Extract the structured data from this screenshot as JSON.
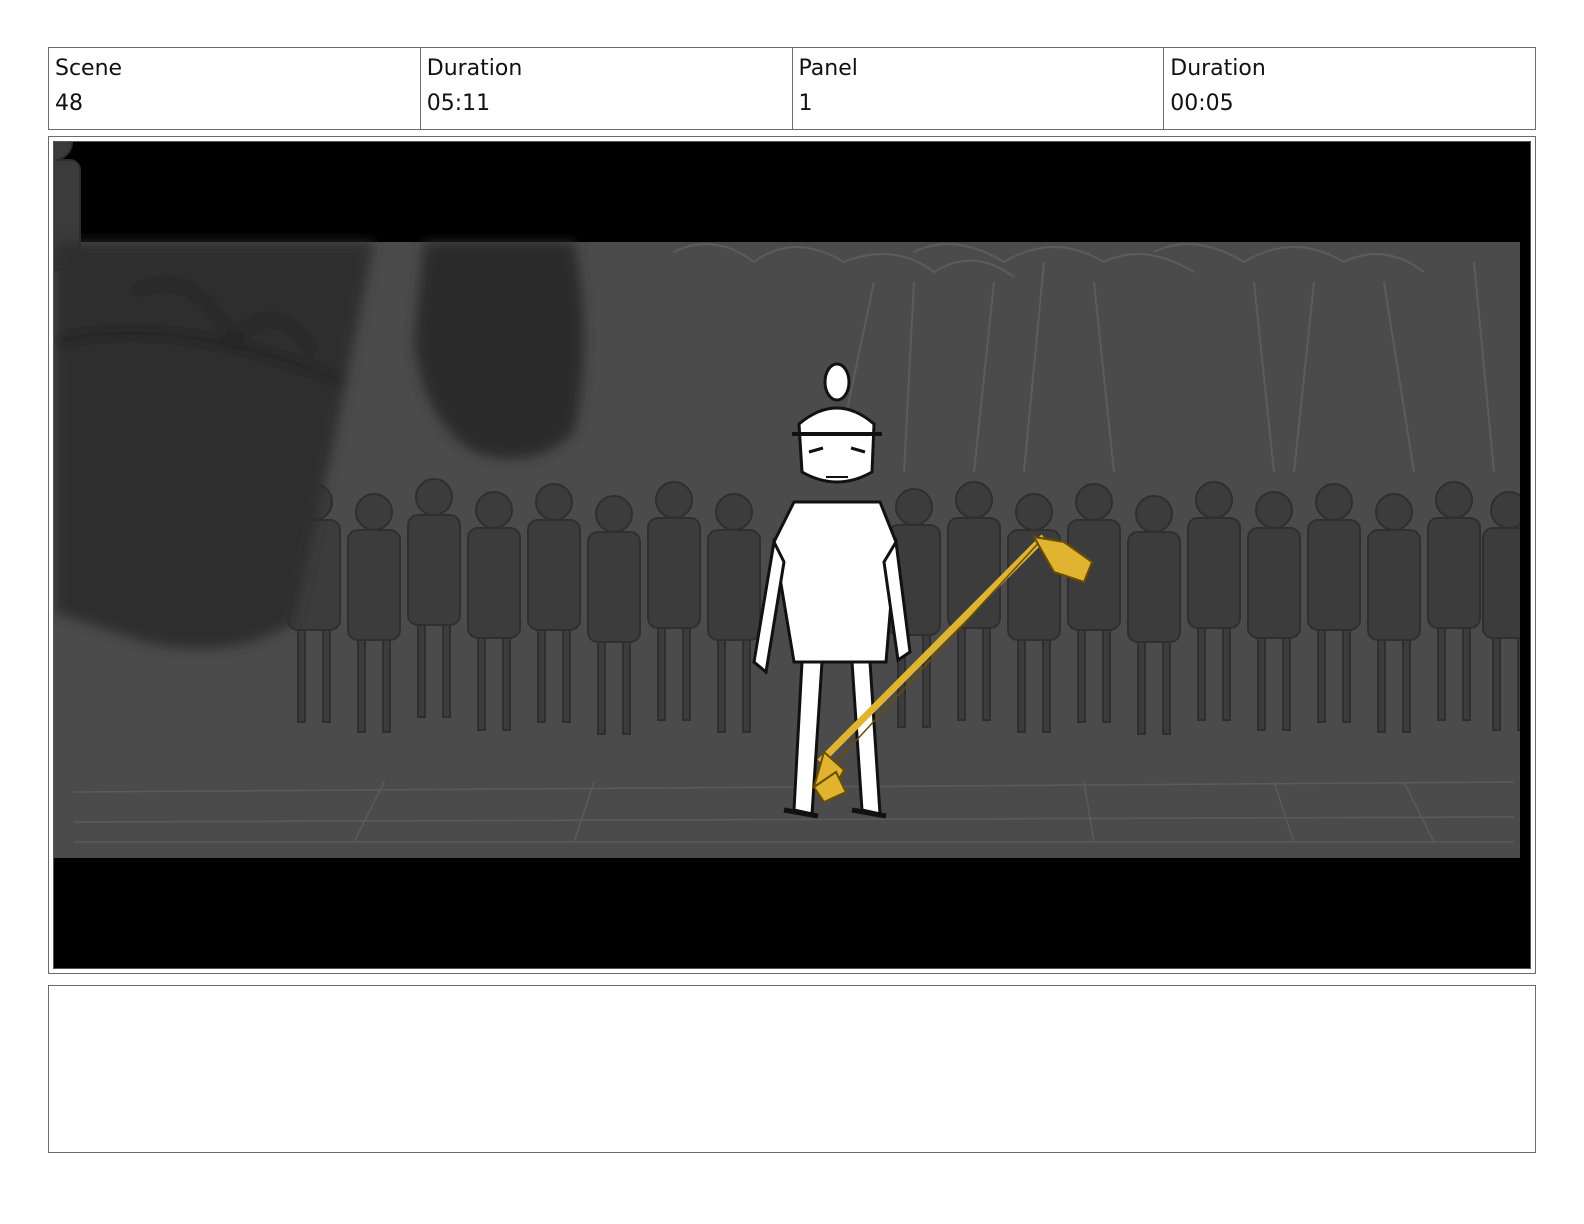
{
  "header": {
    "scene_label": "Scene",
    "scene_value": "48",
    "scene_duration_label": "Duration",
    "scene_duration_value": "05:11",
    "panel_label": "Panel",
    "panel_value": "1",
    "panel_duration_label": "Duration",
    "panel_duration_value": "00:05"
  },
  "panel": {
    "image_kind": "storyboard-sketch",
    "colors": {
      "letterbox": "#000000",
      "background": "#4a4a4a",
      "crowd": "#3a3a3a",
      "foreground_blur": "#2c2c2c",
      "hero": "#ffffff",
      "staff": "#e0b430"
    }
  },
  "notes": {
    "text": ""
  }
}
